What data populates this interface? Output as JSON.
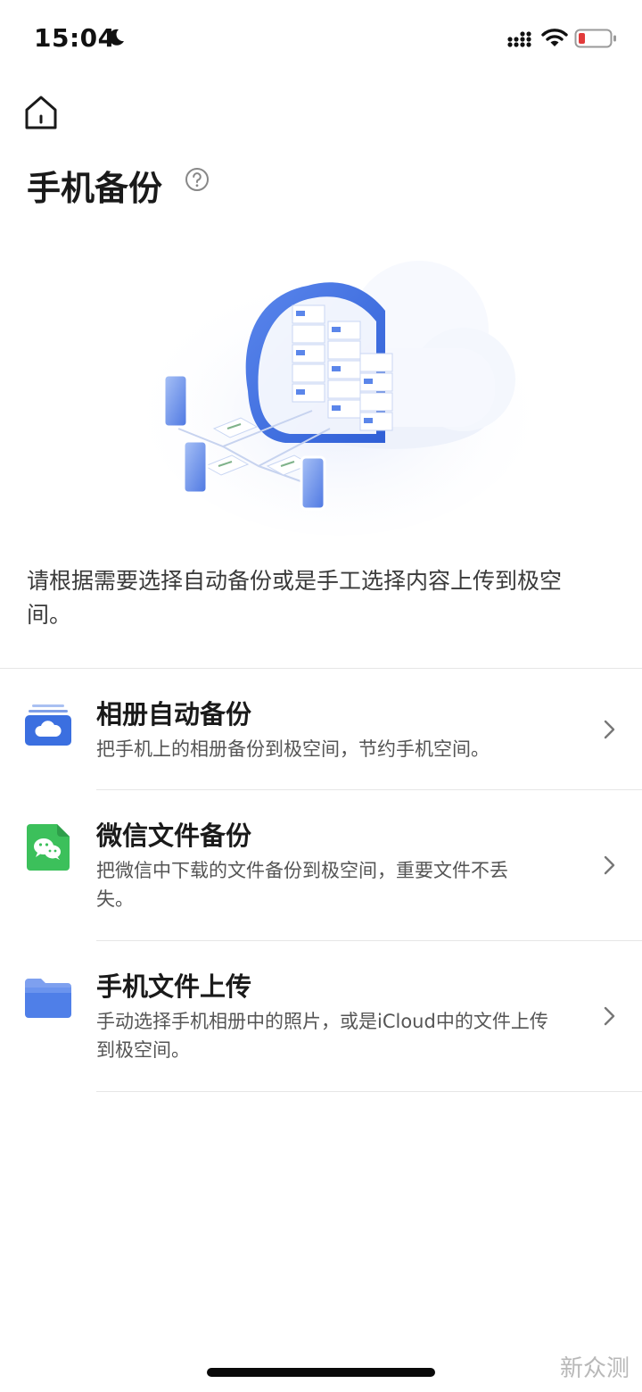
{
  "status_bar": {
    "time": "15:04"
  },
  "header": {
    "title": "手机备份"
  },
  "intro": "请根据需要选择自动备份或是手工选择内容上传到极空间。",
  "options": [
    {
      "title": "相册自动备份",
      "description": "把手机上的相册备份到极空间，节约手机空间。",
      "icon": "cloud-album-icon"
    },
    {
      "title": "微信文件备份",
      "description": "把微信中下载的文件备份到极空间，重要文件不丢失。",
      "icon": "wechat-icon"
    },
    {
      "title": "手机文件上传",
      "description": "手动选择手机相册中的照片，或是iCloud中的文件上传到极空间。",
      "icon": "folder-icon"
    }
  ],
  "watermark": "新众测",
  "colors": {
    "accent_blue": "#3b6fe0",
    "wechat_green": "#3cc05b",
    "battery_low": "#e23b3b"
  }
}
